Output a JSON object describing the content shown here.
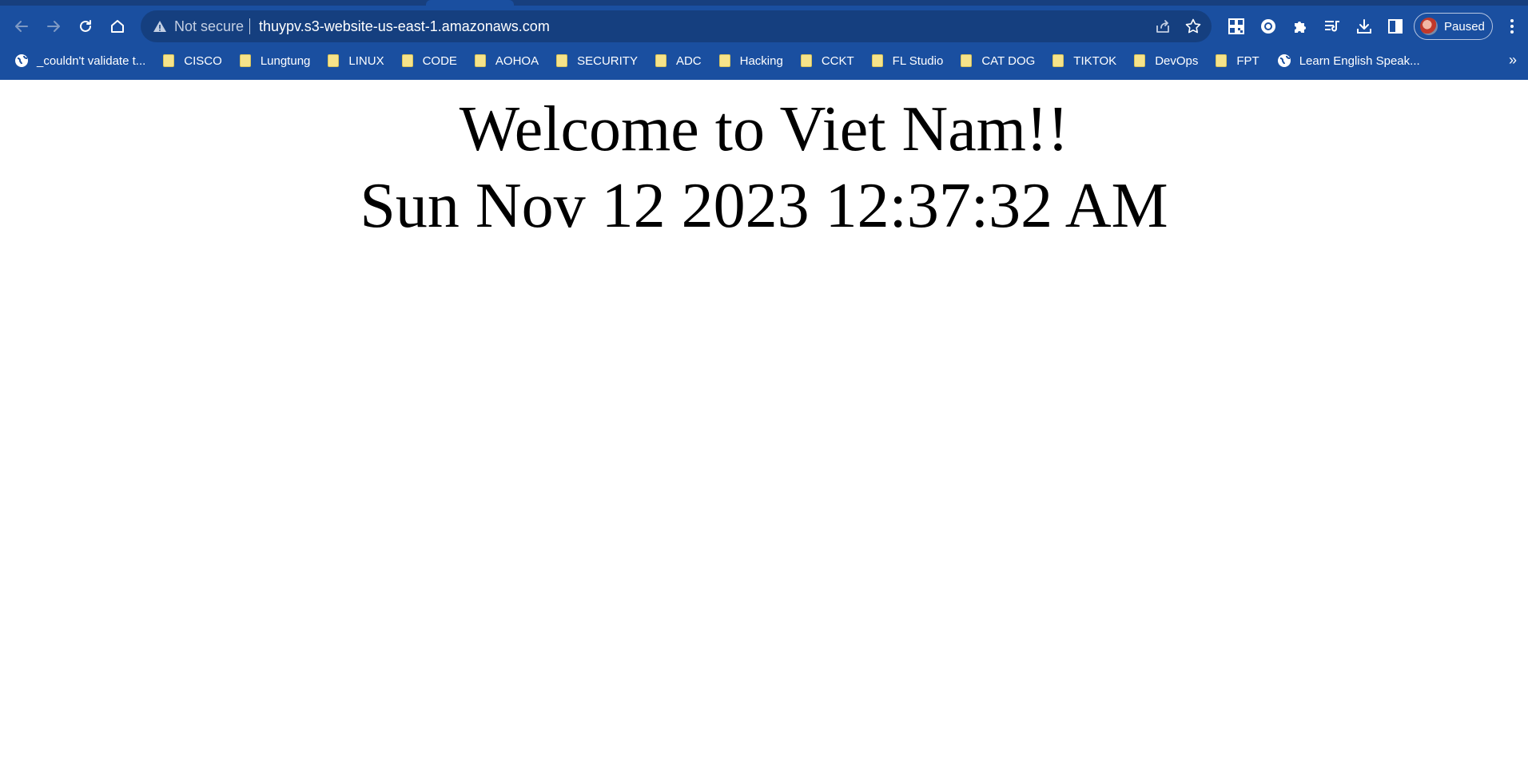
{
  "browser": {
    "omnibox": {
      "security_label": "Not secure",
      "url": "thuypv.s3-website-us-east-1.amazonaws.com"
    },
    "profile": {
      "status": "Paused"
    },
    "bookmarks": [
      {
        "label": "_couldn't validate t...",
        "icon": "globe-icon"
      },
      {
        "label": "CISCO",
        "icon": "folder-icon"
      },
      {
        "label": "Lungtung",
        "icon": "folder-icon"
      },
      {
        "label": "LINUX",
        "icon": "folder-icon"
      },
      {
        "label": "CODE",
        "icon": "folder-icon"
      },
      {
        "label": "AOHOA",
        "icon": "folder-icon"
      },
      {
        "label": "SECURITY",
        "icon": "folder-icon"
      },
      {
        "label": "ADC",
        "icon": "folder-icon"
      },
      {
        "label": "Hacking",
        "icon": "folder-icon"
      },
      {
        "label": "CCKT",
        "icon": "folder-icon"
      },
      {
        "label": "FL Studio",
        "icon": "folder-icon"
      },
      {
        "label": "CAT DOG",
        "icon": "folder-icon"
      },
      {
        "label": "TIKTOK",
        "icon": "folder-icon"
      },
      {
        "label": "DevOps",
        "icon": "folder-icon"
      },
      {
        "label": "FPT",
        "icon": "folder-icon"
      },
      {
        "label": "Learn English Speak...",
        "icon": "globe-icon"
      }
    ],
    "bookmarks_overflow": "»"
  },
  "page": {
    "heading": "Welcome to Viet Nam!!",
    "datetime": "Sun Nov 12 2023 12:37:32 AM"
  },
  "colors": {
    "chrome_bg": "#1a4fa0",
    "omnibox_bg": "#153f7f",
    "folder": "#f6e38a"
  }
}
